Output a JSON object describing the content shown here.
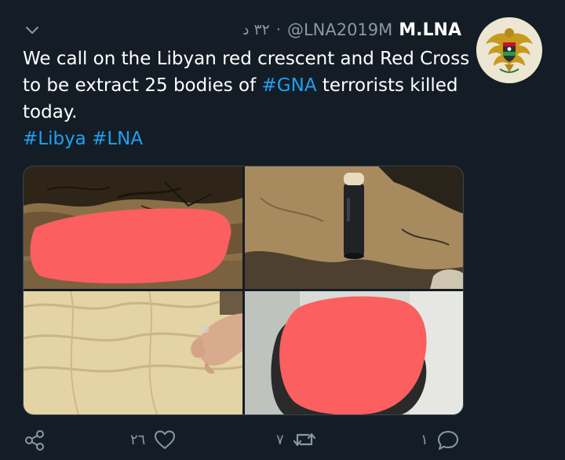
{
  "tweet": {
    "display_name": "M.LNA",
    "handle": "@LNA2019M",
    "separator": "·",
    "time": "٣٢ د",
    "text_parts": [
      {
        "text": "We call on the Libyan red crescent and  Red Cross to be extract 25 bodies of ",
        "type": "text"
      },
      {
        "text": "#GNA",
        "type": "hashtag"
      },
      {
        "text": " terrorists killed today.",
        "type": "text"
      }
    ],
    "hashtags_line": [
      {
        "text": "#Libya",
        "type": "hashtag"
      },
      {
        "text": " ",
        "type": "text"
      },
      {
        "text": "#LNA",
        "type": "hashtag"
      }
    ]
  },
  "media": [
    {
      "name": "photo-burnt-ground",
      "description_icon": "photo"
    },
    {
      "name": "photo-shell-casing",
      "description_icon": "photo"
    },
    {
      "name": "photo-blanket",
      "description_icon": "photo"
    },
    {
      "name": "photo-person-redacted",
      "description_icon": "photo"
    }
  ],
  "actions": {
    "like_count": "٢٦",
    "retweet_count": "٧",
    "reply_count": "١"
  },
  "icons": [
    "chevron-down-icon",
    "share-icon",
    "like-icon",
    "retweet-icon",
    "reply-icon"
  ],
  "colors": {
    "background": "#141d26",
    "text": "#ffffff",
    "muted": "#8899a6",
    "link": "#1da1f2",
    "redaction": "#fb5f5f"
  }
}
